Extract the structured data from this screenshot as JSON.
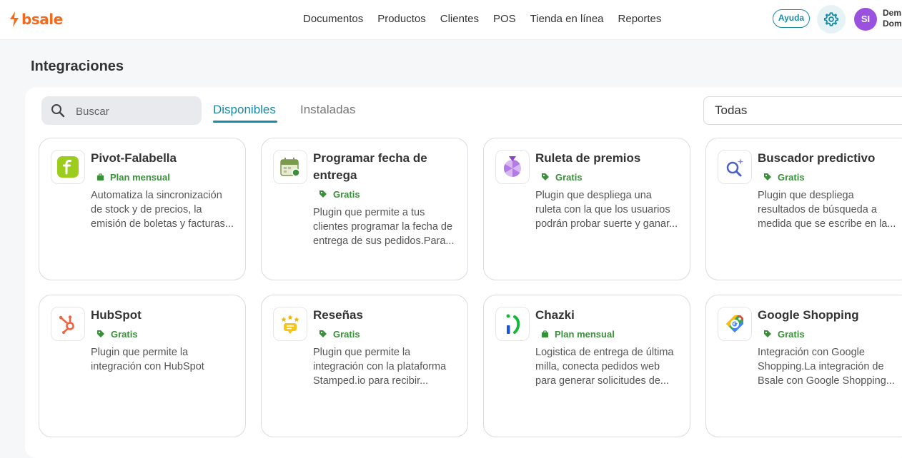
{
  "app": {
    "logo_text": "bsale"
  },
  "nav": [
    "Documentos",
    "Productos",
    "Clientes",
    "POS",
    "Tienda en línea",
    "Reportes"
  ],
  "header": {
    "help_label": "Ayuda",
    "avatar_initials": "SI",
    "user_line1": "Dem",
    "user_line2": "Dom"
  },
  "page": {
    "title": "Integraciones"
  },
  "search": {
    "placeholder": "Buscar",
    "value": ""
  },
  "tabs": [
    {
      "label": "Disponibles",
      "active": true
    },
    {
      "label": "Instaladas",
      "active": false
    }
  ],
  "filter": {
    "selected": "Todas"
  },
  "cards": [
    {
      "title": "Pivot-Falabella",
      "badge": "Plan mensual",
      "badge_icon": "briefcase-icon",
      "icon": "falabella-icon",
      "description": "Automatiza la sincronización de stock y de precios, la emisión de boletas y facturas..."
    },
    {
      "title": "Programar fecha de entrega",
      "badge": "Gratis",
      "badge_icon": "tag-icon",
      "icon": "calendar-icon",
      "description": "Plugin que permite a tus clientes programar la fecha de entrega de sus pedidos.Para..."
    },
    {
      "title": "Ruleta de premios",
      "badge": "Gratis",
      "badge_icon": "tag-icon",
      "icon": "prize-wheel-icon",
      "description": "Plugin que despliega una ruleta con la que los usuarios podrán probar suerte y ganar..."
    },
    {
      "title": "Buscador predictivo",
      "badge": "Gratis",
      "badge_icon": "tag-icon",
      "icon": "magnifier-sparkle-icon",
      "description": "Plugin que despliega resultados de búsqueda a medida que se escribe en la..."
    },
    {
      "title": "HubSpot",
      "badge": "Gratis",
      "badge_icon": "tag-icon",
      "icon": "hubspot-icon",
      "description": "Plugin que permite la integración con HubSpot"
    },
    {
      "title": "Reseñas",
      "badge": "Gratis",
      "badge_icon": "tag-icon",
      "icon": "reviews-stars-icon",
      "description": "Plugin que permite la integración con la plataforma Stamped.io para recibir..."
    },
    {
      "title": "Chazki",
      "badge": "Plan mensual",
      "badge_icon": "briefcase-icon",
      "icon": "chazki-icon",
      "description": "Logistica de entrega de última milla, conecta pedidos web para generar solicitudes de..."
    },
    {
      "title": "Google Shopping",
      "badge": "Gratis",
      "badge_icon": "tag-icon",
      "icon": "google-shopping-icon",
      "description": "Integración con Google Shopping.La integración de Bsale con Google Shopping..."
    }
  ],
  "colors": {
    "brand_orange": "#f26a1b",
    "accent_teal": "#1a8aa5",
    "badge_green": "#3a8f3a",
    "avatar_purple": "#9b51e0"
  }
}
